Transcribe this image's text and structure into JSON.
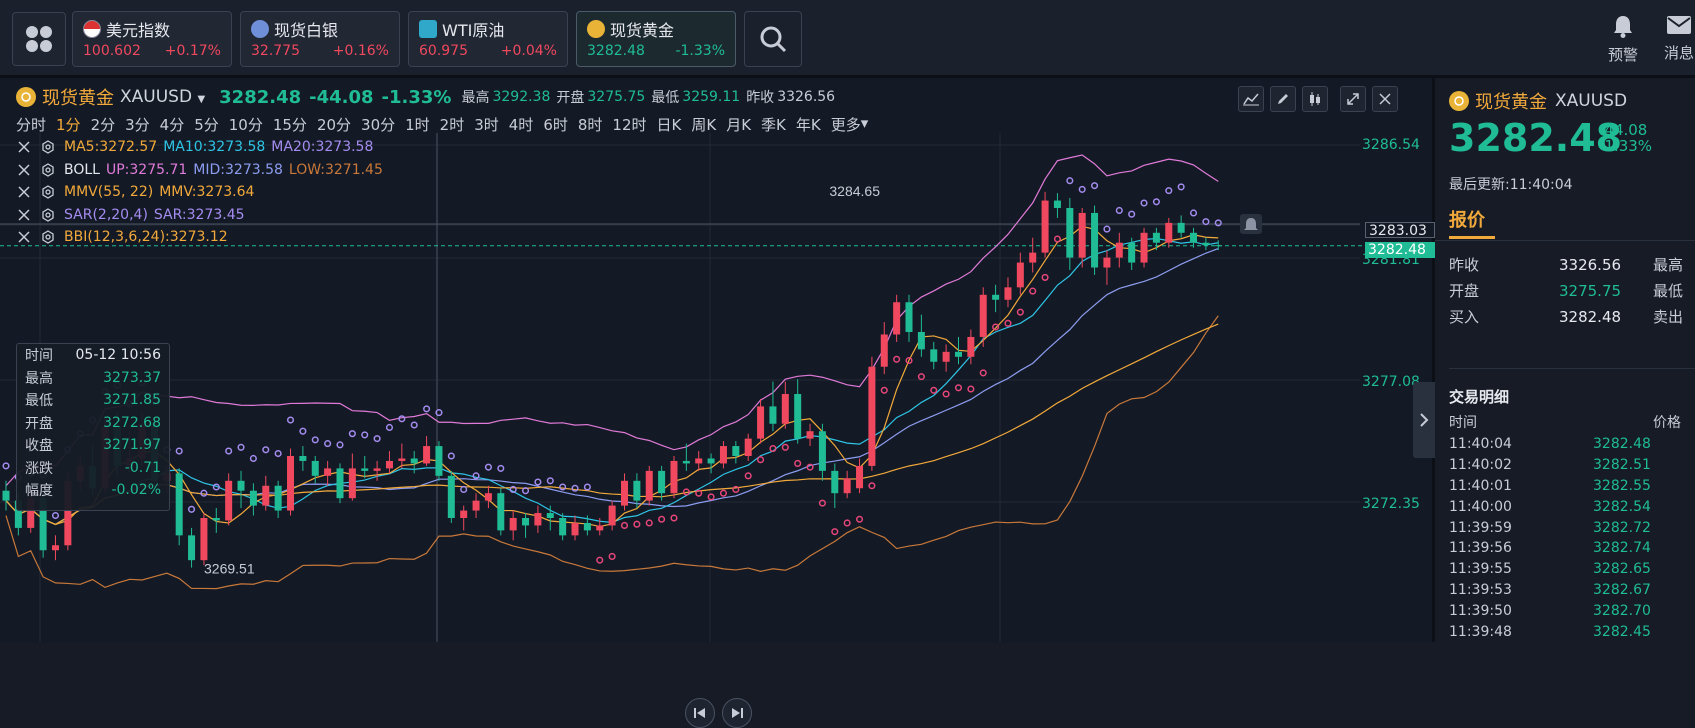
{
  "topbar": {
    "tickers": [
      {
        "name": "美元指数",
        "price": "100.602",
        "change": "+0.17%",
        "icon": "us-flag-icon"
      },
      {
        "name": "现货白银",
        "price": "32.775",
        "change": "+0.16%",
        "icon": "silver-icon"
      },
      {
        "name": "WTI原油",
        "price": "60.975",
        "change": "+0.04%",
        "icon": "oil-icon"
      },
      {
        "name": "现货黄金",
        "price": "3282.48",
        "change": "-1.33%",
        "icon": "gold-icon"
      }
    ],
    "alert_label": "预警",
    "message_label": "消息"
  },
  "header": {
    "name": "现货黄金",
    "code": "XAUUSD",
    "price": "3282.48",
    "change": "-44.08",
    "change_pct": "-1.33%",
    "high_label": "最高",
    "high": "3292.38",
    "open_label": "开盘",
    "open": "3275.75",
    "low_label": "最低",
    "low": "3259.11",
    "prev_label": "昨收",
    "prev": "3326.56"
  },
  "intervals": [
    "分时",
    "1分",
    "2分",
    "3分",
    "4分",
    "5分",
    "10分",
    "15分",
    "20分",
    "30分",
    "1时",
    "2时",
    "3时",
    "4时",
    "6时",
    "8时",
    "12时",
    "日K",
    "周K",
    "月K",
    "季K",
    "年K",
    "更多"
  ],
  "active_interval": "1分",
  "indicators": [
    {
      "parts": [
        {
          "t": "MA5:3272.57",
          "c": "#f2a93b"
        },
        {
          "t": "MA10:3273.58",
          "c": "#2ec4e6"
        },
        {
          "t": "MA20:3273.58",
          "c": "#a48cf0"
        }
      ]
    },
    {
      "parts": [
        {
          "t": "BOLL",
          "c": "#e6e8ee"
        },
        {
          "t": "UP:3275.71",
          "c": "#e07ad8"
        },
        {
          "t": "MID:3273.58",
          "c": "#8c9cf0"
        },
        {
          "t": "LOW:3271.45",
          "c": "#c8783a"
        }
      ]
    },
    {
      "parts": [
        {
          "t": "MMV(55, 22)",
          "c": "#f2a93b"
        },
        {
          "t": "MMV:3273.64",
          "c": "#f2a93b"
        }
      ]
    },
    {
      "parts": [
        {
          "t": "SAR(2,20,4)",
          "c": "#a48cf0"
        },
        {
          "t": "SAR:3273.45",
          "c": "#a48cf0"
        }
      ]
    },
    {
      "parts": [
        {
          "t": "BBI(12,3,6,24):3273.12",
          "c": "#f2a93b"
        }
      ]
    }
  ],
  "yaxis": [
    "3286.54",
    "3283.03",
    "3281.81",
    "3277.08",
    "3272.35"
  ],
  "current_tag": "3282.48",
  "hl_labels": {
    "high": "3284.65",
    "low": "3269.51"
  },
  "tooltip": [
    {
      "k": "时间",
      "v": "05-12 10:56"
    },
    {
      "k": "最高",
      "v": "3273.37"
    },
    {
      "k": "最低",
      "v": "3271.85"
    },
    {
      "k": "开盘",
      "v": "3272.68"
    },
    {
      "k": "收盘",
      "v": "3271.97"
    },
    {
      "k": "涨跌",
      "v": "-0.71"
    },
    {
      "k": "幅度",
      "v": "-0.02%"
    }
  ],
  "right_panel": {
    "name": "现货黄金",
    "code": "XAUUSD",
    "price": "3282.48",
    "change": "-44.08",
    "change_pct": "-1.33%",
    "updated": "最后更新:11:40:04",
    "tab": "报价",
    "quotes": [
      {
        "k": "昨收",
        "v": "3326.56",
        "k2": "最高",
        "color": "w"
      },
      {
        "k": "开盘",
        "v": "3275.75",
        "k2": "最低",
        "color": "g"
      },
      {
        "k": "买入",
        "v": "3282.48",
        "k2": "卖出",
        "color": "w"
      }
    ],
    "detail_title": "交易明细",
    "col_time": "时间",
    "col_price": "价格",
    "trades": [
      [
        "11:40:04",
        "3282.48"
      ],
      [
        "11:40:02",
        "3282.51"
      ],
      [
        "11:40:01",
        "3282.55"
      ],
      [
        "11:40:00",
        "3282.54"
      ],
      [
        "11:39:59",
        "3282.72"
      ],
      [
        "11:39:56",
        "3282.74"
      ],
      [
        "11:39:55",
        "3282.65"
      ],
      [
        "11:39:53",
        "3282.67"
      ],
      [
        "11:39:50",
        "3282.70"
      ],
      [
        "11:39:48",
        "3282.45"
      ]
    ]
  },
  "candles": [
    [
      3272.6,
      3272.2,
      3273.0,
      3271.8
    ],
    [
      3272.2,
      3271.1,
      3272.5,
      3270.8
    ],
    [
      3271.1,
      3272.3,
      3272.6,
      3270.9
    ],
    [
      3272.3,
      3270.2,
      3272.5,
      3269.9
    ],
    [
      3270.2,
      3270.4,
      3270.8,
      3269.8
    ],
    [
      3270.4,
      3273.0,
      3273.4,
      3270.2
    ],
    [
      3273.0,
      3273.6,
      3274.0,
      3272.6
    ],
    [
      3273.6,
      3272.7,
      3274.5,
      3272.4
    ],
    [
      3272.7,
      3275.2,
      3275.6,
      3272.5
    ],
    [
      3275.2,
      3273.6,
      3275.8,
      3273.2
    ],
    [
      3273.6,
      3273.9,
      3275.0,
      3273.3
    ],
    [
      3273.9,
      3275.3,
      3275.8,
      3273.6
    ],
    [
      3275.3,
      3273.0,
      3275.6,
      3272.8
    ],
    [
      3273.0,
      3273.3,
      3273.6,
      3272.5
    ],
    [
      3273.3,
      3270.8,
      3273.5,
      3270.4
    ],
    [
      3270.8,
      3269.8,
      3271.1,
      3269.5
    ],
    [
      3269.8,
      3271.5,
      3271.7,
      3269.6
    ],
    [
      3271.5,
      3271.4,
      3271.9,
      3270.9
    ],
    [
      3271.4,
      3273.0,
      3273.3,
      3271.2
    ],
    [
      3273.0,
      3272.6,
      3273.4,
      3271.9
    ],
    [
      3272.6,
      3272.0,
      3272.9,
      3271.6
    ],
    [
      3272.0,
      3272.8,
      3273.2,
      3271.8
    ],
    [
      3272.8,
      3271.8,
      3273.0,
      3271.5
    ],
    [
      3271.8,
      3274.0,
      3274.3,
      3271.6
    ],
    [
      3274.0,
      3273.8,
      3274.4,
      3273.4
    ],
    [
      3273.8,
      3273.2,
      3274.0,
      3272.9
    ],
    [
      3273.2,
      3273.5,
      3273.8,
      3272.8
    ],
    [
      3273.5,
      3272.3,
      3273.7,
      3272.1
    ],
    [
      3272.3,
      3273.5,
      3274.1,
      3272.2
    ],
    [
      3273.5,
      3273.4,
      3274.0,
      3273.1
    ],
    [
      3273.4,
      3273.5,
      3273.8,
      3273.0
    ],
    [
      3273.5,
      3273.8,
      3274.2,
      3273.3
    ],
    [
      3273.8,
      3273.9,
      3274.5,
      3273.5
    ],
    [
      3273.9,
      3273.7,
      3274.2,
      3273.3
    ],
    [
      3273.7,
      3274.4,
      3274.8,
      3273.6
    ],
    [
      3274.4,
      3273.2,
      3274.6,
      3273.0
    ],
    [
      3273.2,
      3271.5,
      3273.4,
      3271.3
    ],
    [
      3271.5,
      3271.8,
      3272.0,
      3271.0
    ],
    [
      3271.8,
      3272.2,
      3272.5,
      3271.5
    ],
    [
      3272.2,
      3272.5,
      3272.8,
      3271.9
    ],
    [
      3272.5,
      3271.0,
      3272.7,
      3270.8
    ],
    [
      3271.0,
      3271.5,
      3271.8,
      3270.6
    ],
    [
      3271.5,
      3271.2,
      3271.7,
      3270.7
    ],
    [
      3271.2,
      3271.7,
      3272.0,
      3270.9
    ],
    [
      3271.7,
      3271.5,
      3272.0,
      3271.0
    ],
    [
      3271.5,
      3270.8,
      3271.7,
      3270.6
    ],
    [
      3270.8,
      3271.3,
      3271.6,
      3270.6
    ],
    [
      3271.3,
      3271.0,
      3271.6,
      3270.8
    ],
    [
      3271.0,
      3271.2,
      3271.5,
      3270.8
    ],
    [
      3271.2,
      3272.0,
      3272.2,
      3271.0
    ],
    [
      3272.0,
      3273.0,
      3273.3,
      3271.8
    ],
    [
      3273.0,
      3272.2,
      3273.3,
      3271.9
    ],
    [
      3272.2,
      3273.4,
      3273.6,
      3272.0
    ],
    [
      3273.4,
      3272.5,
      3273.6,
      3272.2
    ],
    [
      3272.5,
      3273.8,
      3274.0,
      3272.3
    ],
    [
      3273.8,
      3273.7,
      3274.5,
      3273.4
    ],
    [
      3273.7,
      3273.9,
      3274.2,
      3273.4
    ],
    [
      3273.9,
      3273.7,
      3274.1,
      3273.3
    ],
    [
      3273.7,
      3274.4,
      3274.6,
      3273.5
    ],
    [
      3274.4,
      3274.0,
      3274.6,
      3273.7
    ],
    [
      3274.0,
      3274.7,
      3274.9,
      3273.8
    ],
    [
      3274.7,
      3276.0,
      3276.3,
      3274.5
    ],
    [
      3276.0,
      3275.3,
      3277.0,
      3275.0
    ],
    [
      3275.3,
      3276.5,
      3277.0,
      3275.1
    ],
    [
      3276.5,
      3274.7,
      3277.1,
      3274.5
    ],
    [
      3274.7,
      3275.0,
      3275.3,
      3274.4
    ],
    [
      3275.0,
      3273.4,
      3275.3,
      3273.0
    ],
    [
      3273.4,
      3272.5,
      3273.7,
      3271.9
    ],
    [
      3272.5,
      3273.1,
      3273.4,
      3272.3
    ],
    [
      3272.7,
      3273.6,
      3273.9,
      3272.5
    ],
    [
      3273.6,
      3277.6,
      3278.0,
      3273.4
    ],
    [
      3277.6,
      3278.9,
      3279.4,
      3277.3
    ],
    [
      3278.9,
      3280.2,
      3280.5,
      3278.6
    ],
    [
      3280.2,
      3279.0,
      3280.5,
      3278.6
    ],
    [
      3279.0,
      3278.3,
      3279.7,
      3278.0
    ],
    [
      3278.3,
      3277.8,
      3278.6,
      3277.5
    ],
    [
      3277.8,
      3278.2,
      3278.5,
      3277.4
    ],
    [
      3278.2,
      3278.0,
      3278.8,
      3277.7
    ],
    [
      3278.0,
      3278.8,
      3279.1,
      3277.7
    ],
    [
      3278.8,
      3280.5,
      3280.8,
      3278.4
    ],
    [
      3280.5,
      3280.3,
      3280.9,
      3279.8
    ],
    [
      3280.3,
      3280.8,
      3281.2,
      3280.0
    ],
    [
      3280.8,
      3281.8,
      3282.2,
      3280.5
    ],
    [
      3281.8,
      3282.2,
      3282.8,
      3281.4
    ],
    [
      3282.2,
      3284.3,
      3284.65,
      3282.0
    ],
    [
      3284.3,
      3284.0,
      3284.6,
      3283.6
    ],
    [
      3284.0,
      3282.0,
      3284.4,
      3281.5
    ],
    [
      3282.0,
      3283.8,
      3284.0,
      3281.6
    ],
    [
      3283.8,
      3281.6,
      3284.1,
      3281.3
    ],
    [
      3281.6,
      3282.0,
      3282.3,
      3280.9
    ],
    [
      3282.0,
      3282.6,
      3283.0,
      3281.6
    ],
    [
      3282.6,
      3281.8,
      3282.8,
      3281.5
    ],
    [
      3281.8,
      3283.0,
      3283.2,
      3281.6
    ],
    [
      3283.0,
      3282.6,
      3283.2,
      3282.3
    ],
    [
      3282.6,
      3283.4,
      3283.6,
      3282.4
    ],
    [
      3283.4,
      3283.0,
      3283.7,
      3282.8
    ],
    [
      3283.0,
      3282.6,
      3283.2,
      3282.4
    ],
    [
      3282.6,
      3282.5,
      3282.8,
      3282.3
    ],
    [
      3282.5,
      3282.48,
      3282.7,
      3282.3
    ]
  ]
}
